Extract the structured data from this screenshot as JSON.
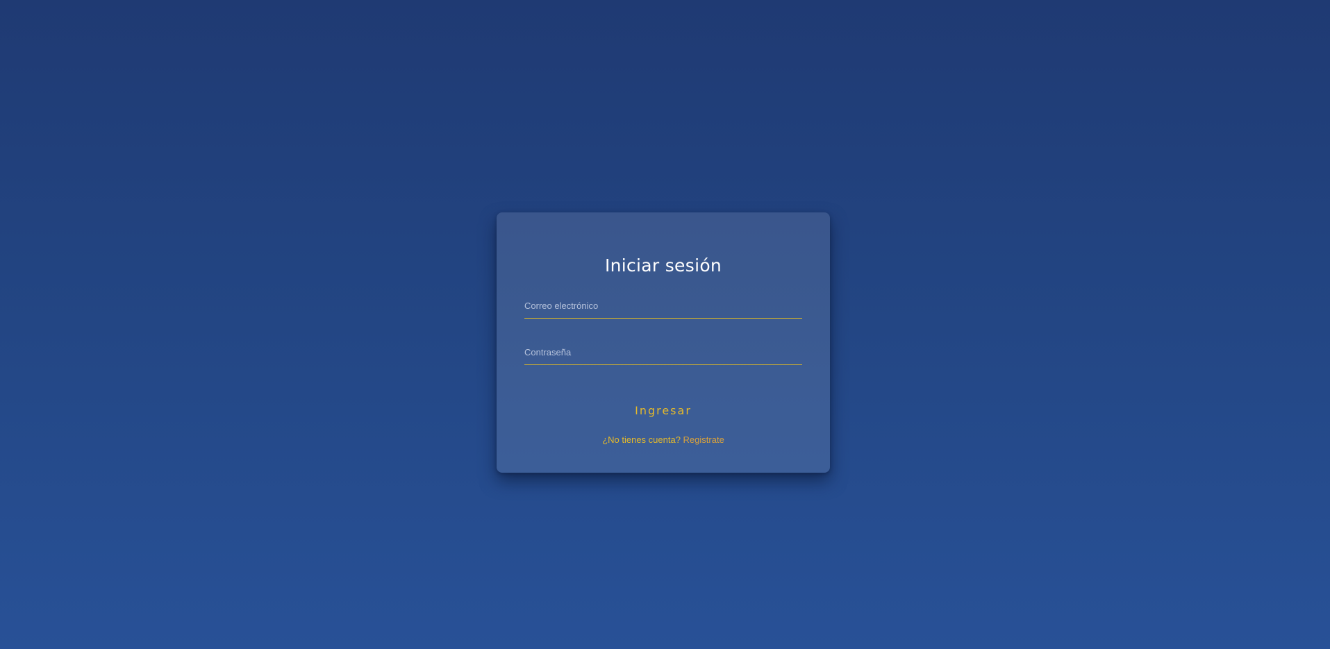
{
  "login": {
    "title": "Iniciar sesión",
    "email": {
      "placeholder": "Correo electrónico",
      "value": ""
    },
    "password": {
      "placeholder": "Contraseña",
      "value": ""
    },
    "submit_label": "Ingresar",
    "register_prompt": "¿No tienes cuenta?",
    "register_link_label": "Registrate"
  },
  "colors": {
    "background_top": "#1f3a73",
    "background_bottom": "#285197",
    "accent": "#e4b92b",
    "link": "#d9a23c",
    "title": "#ffffff"
  }
}
